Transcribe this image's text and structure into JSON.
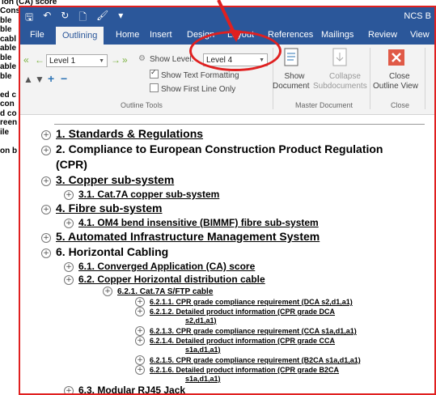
{
  "background": {
    "top_text": "ion (CA) score",
    "left_lines": [
      "Cons tr",
      "ble",
      "ble",
      "cabl",
      "able",
      "ble",
      "able",
      "ble",
      "",
      "ed c",
      "con",
      "d co",
      "reen",
      "ile",
      "",
      "on b"
    ]
  },
  "window": {
    "doc_title": "NCS B",
    "qat": {
      "save": "🖫",
      "undo": "↶",
      "redo": "↻",
      "preview": "🗋",
      "brush": "🖌",
      "more": "▾"
    },
    "tabs": [
      "File",
      "Outlining",
      "Home",
      "Insert",
      "Design",
      "Layout",
      "References",
      "Mailings",
      "Review",
      "View"
    ],
    "active_tab": "Outlining"
  },
  "ribbon": {
    "outline_level": "Level 1",
    "show_level_label": "Show Level:",
    "show_level_value": "Level 4",
    "show_text_formatting": "Show Text Formatting",
    "show_first_line_only": "Show First Line Only",
    "outline_tools_label": "Outline Tools",
    "show_document": [
      "Show",
      "Document"
    ],
    "collapse_subdocuments": [
      "Collapse",
      "Subdocuments"
    ],
    "master_document_label": "Master Document",
    "close_outline_view": [
      "Close",
      "Outline View"
    ],
    "close_group_label": "Close"
  },
  "outline": [
    {
      "level": 1,
      "text": "1. Standards & Regulations"
    },
    {
      "level": 1,
      "text": "2. Compliance to European Construction Product Regulation"
    },
    {
      "level": 1,
      "text": "(CPR)"
    },
    {
      "level": 1,
      "text": "3. Copper sub-system"
    },
    {
      "level": 2,
      "text": "3.1.        Cat.7A copper sub-system"
    },
    {
      "level": 1,
      "text": "4. Fibre sub-system"
    },
    {
      "level": 2,
      "text": "4.1.        OM4 bend insensitive (BIMMF) fibre sub-system"
    },
    {
      "level": 1,
      "text": "5. Automated Infrastructure Management System"
    },
    {
      "level": 1,
      "text": "6. Horizontal Cabling"
    },
    {
      "level": 2,
      "text": "6.1.        Converged Application (CA) score"
    },
    {
      "level": 2,
      "text": "6.2.        Copper Horizontal distribution cable"
    },
    {
      "level": 3,
      "text": "6.2.1.        Cat.7A S/FTP cable"
    },
    {
      "level": 4,
      "text": "6.2.1.1.        CPR grade compliance requirement (DCA s2,d1,a1)"
    },
    {
      "level": 4,
      "text": "6.2.1.2.        Detailed product information (CPR grade DCA"
    },
    {
      "level": 4,
      "text": "s2,d1,a1)"
    },
    {
      "level": 4,
      "text": "6.2.1.3.        CPR grade compliance requirement (CCA s1a,d1,a1)"
    },
    {
      "level": 4,
      "text": "6.2.1.4.        Detailed product information (CPR grade CCA"
    },
    {
      "level": 4,
      "text": "s1a,d1,a1)"
    },
    {
      "level": 4,
      "text": "6.2.1.5.        CPR grade compliance requirement (B2CA s1a,d1,a1)"
    },
    {
      "level": 4,
      "text": "6.2.1.6.        Detailed product information (CPR grade B2CA"
    },
    {
      "level": 4,
      "text": "s1a,d1,a1)"
    },
    {
      "level": 2,
      "text": "6.3.        Modular RJ45 Jack"
    }
  ]
}
